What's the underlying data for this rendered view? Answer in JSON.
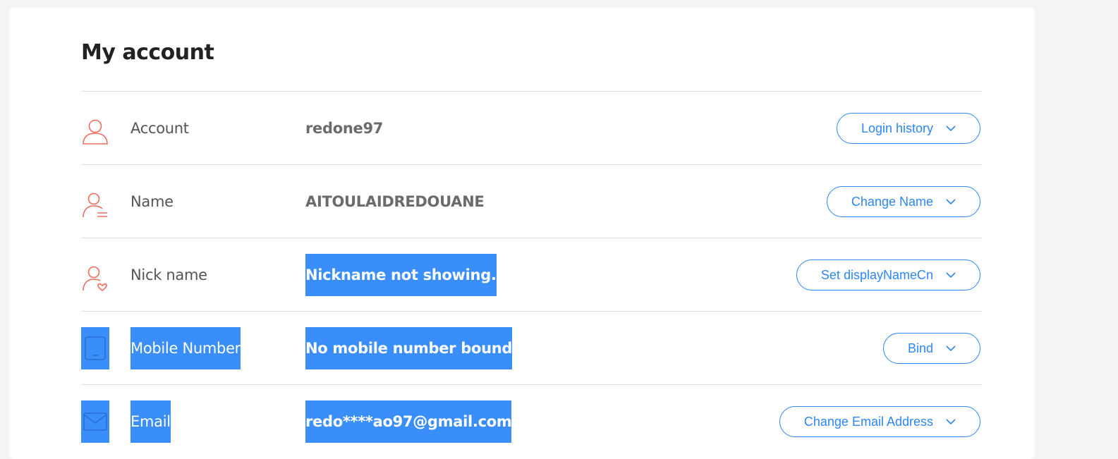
{
  "page": {
    "title": "My account"
  },
  "colors": {
    "accent": "#2f86f6",
    "icon": "#f26b5e",
    "highlight": "#3a8ef9"
  },
  "rows": [
    {
      "icon": "user-icon",
      "label": "Account",
      "value": "redone97",
      "button": "Login history"
    },
    {
      "icon": "user-list-icon",
      "label": "Name",
      "value": "AITOULAIDREDOUANE",
      "button": "Change Name"
    },
    {
      "icon": "user-heart-icon",
      "label": "Nick name",
      "value": "Nickname not showing.",
      "button": "Set displayNameCn"
    },
    {
      "icon": "mobile-icon",
      "label": "Mobile Number",
      "value": "No mobile number bound",
      "button": "Bind"
    },
    {
      "icon": "mail-icon",
      "label": "Email",
      "value": "redo****ao97@gmail.com",
      "button": "Change Email Address"
    }
  ]
}
